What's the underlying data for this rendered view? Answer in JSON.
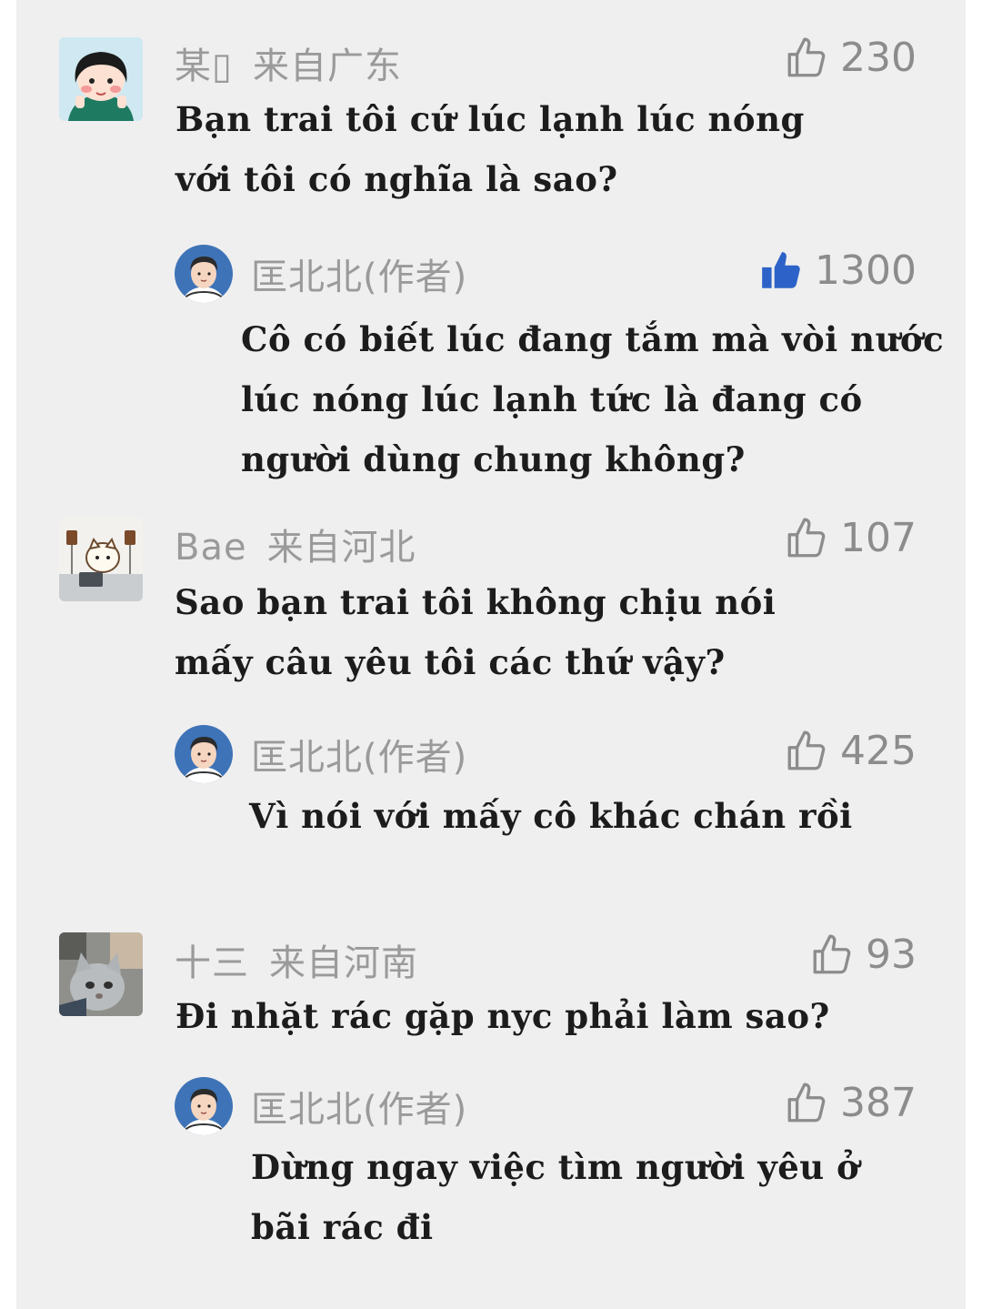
{
  "comments": [
    {
      "user": "某▯",
      "location": "来自广东",
      "likes": "230",
      "text_lines": [
        "Bạn trai tôi cứ lúc lạnh lúc nóng",
        "với tôi có nghĩa là sao?"
      ],
      "reply": {
        "user": "匡北北(作者)",
        "likes": "1300",
        "liked": true,
        "text_lines": [
          "Cô có biết lúc đang tắm mà vòi nước",
          "lúc nóng lúc lạnh tức là đang có",
          "người dùng chung không?"
        ]
      }
    },
    {
      "user": "Bae",
      "location": "来自河北",
      "likes": "107",
      "text_lines": [
        "Sao bạn trai tôi không chịu nói",
        "mấy câu yêu tôi các thứ vậy?"
      ],
      "reply": {
        "user": "匡北北(作者)",
        "likes": "425",
        "liked": false,
        "text_lines": [
          "Vì nói với mấy cô khác chán rồi"
        ]
      }
    },
    {
      "user": "十三",
      "location": "来自河南",
      "likes": "93",
      "text_lines": [
        "Đi nhặt rác gặp nyc phải làm sao?"
      ],
      "reply": {
        "user": "匡北北(作者)",
        "likes": "387",
        "liked": false,
        "text_lines": [
          "Dừng ngay việc tìm người yêu ở",
          "bãi rác đi"
        ]
      }
    }
  ],
  "colors": {
    "background": "#efefef",
    "meta_text": "#9a9a9a",
    "like_outline": "#8c8c8c",
    "like_filled": "#2d63c8",
    "body_text": "#1c1c1c"
  }
}
